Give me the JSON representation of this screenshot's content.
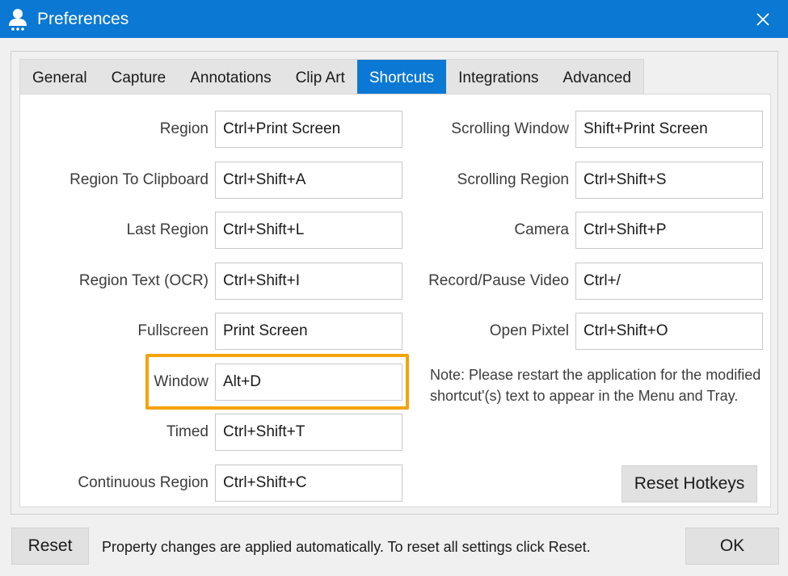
{
  "window": {
    "title": "Preferences",
    "accent_color": "#0b78d4",
    "app_icon": "user-icon",
    "close_icon": "close-icon"
  },
  "tabs": [
    {
      "label": "General",
      "active": false
    },
    {
      "label": "Capture",
      "active": false
    },
    {
      "label": "Annotations",
      "active": false
    },
    {
      "label": "Clip Art",
      "active": false
    },
    {
      "label": "Shortcuts",
      "active": true
    },
    {
      "label": "Integrations",
      "active": false
    },
    {
      "label": "Advanced",
      "active": false
    }
  ],
  "shortcuts_left": [
    {
      "label": "Region",
      "value": "Ctrl+Print Screen"
    },
    {
      "label": "Region To Clipboard",
      "value": "Ctrl+Shift+A"
    },
    {
      "label": "Last Region",
      "value": "Ctrl+Shift+L"
    },
    {
      "label": "Region Text (OCR)",
      "value": "Ctrl+Shift+I"
    },
    {
      "label": "Fullscreen",
      "value": "Print Screen"
    },
    {
      "label": "Window",
      "value": "Alt+D",
      "highlighted": true
    },
    {
      "label": "Timed",
      "value": "Ctrl+Shift+T"
    },
    {
      "label": "Continuous Region",
      "value": "Ctrl+Shift+C"
    }
  ],
  "shortcuts_right": [
    {
      "label": "Scrolling Window",
      "value": "Shift+Print Screen"
    },
    {
      "label": "Scrolling Region",
      "value": "Ctrl+Shift+S"
    },
    {
      "label": "Camera",
      "value": "Ctrl+Shift+P"
    },
    {
      "label": "Record/Pause Video",
      "value": "Ctrl+/"
    },
    {
      "label": "Open Pixtel",
      "value": "Ctrl+Shift+O"
    }
  ],
  "highlight_color": "#f5a20b",
  "note": "Note: Please restart the application for the modified shortcut'(s) text to appear in the Menu and Tray.",
  "buttons": {
    "reset_hotkeys": "Reset Hotkeys",
    "reset": "Reset",
    "ok": "OK"
  },
  "footer_text": "Property changes are applied automatically. To reset all settings click Reset."
}
